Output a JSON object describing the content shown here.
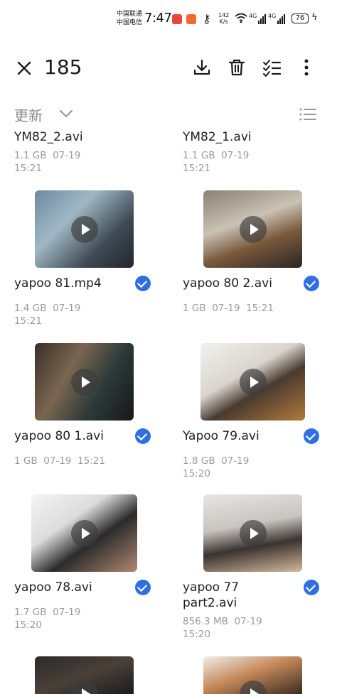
{
  "status_bar": {
    "carrier_1": "中国联通",
    "carrier_2": "中国电信",
    "time": "7:47",
    "speed_value": "142",
    "speed_unit": "K/s",
    "net_1": "4G",
    "net_2": "4G",
    "battery": "76"
  },
  "toolbar": {
    "selected_count": "185",
    "icons": [
      "close-icon",
      "download-icon",
      "delete-icon",
      "select-all-icon",
      "more-icon"
    ]
  },
  "sort": {
    "label": "更新"
  },
  "files": [
    {
      "name": "YM82_2.avi",
      "size": "1.1 GB",
      "date": "07-19",
      "time": "15:21",
      "checked": false
    },
    {
      "name": "YM82_1.avi",
      "size": "1.1 GB",
      "date": "07-19",
      "time": "15:21",
      "checked": false
    },
    {
      "name": "yapoo 81.mp4",
      "size": "1.4 GB",
      "date": "07-19",
      "time": "15:21",
      "checked": true
    },
    {
      "name": "yapoo 80 2.avi",
      "size": "1 GB",
      "date": "07-19",
      "time": "15:21",
      "checked": true
    },
    {
      "name": "yapoo 80 1.avi",
      "size": "1 GB",
      "date": "07-19",
      "time": "15:21",
      "checked": true
    },
    {
      "name": "Yapoo 79.avi",
      "size": "1.8 GB",
      "date": "07-19",
      "time": "15:20",
      "checked": true
    },
    {
      "name": "yapoo 78.avi",
      "size": "1.7 GB",
      "date": "07-19",
      "time": "15:20",
      "checked": true
    },
    {
      "name": "yapoo 77 part2.avi",
      "name_line1": "yapoo 77",
      "name_line2": "part2.avi",
      "size": "856.3 MB",
      "date": "07-19",
      "time": "15:20",
      "checked": true
    }
  ],
  "colors": {
    "accent": "#2f6fe4",
    "meta_text": "#9a9a9a"
  }
}
